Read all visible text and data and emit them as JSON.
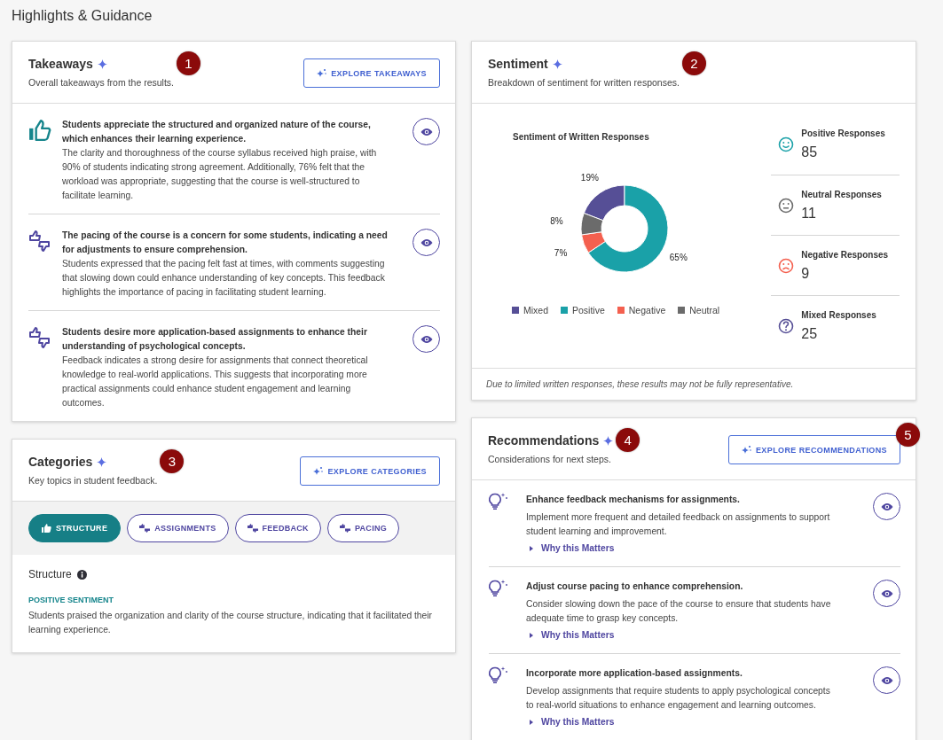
{
  "page_title": "Highlights & Guidance",
  "takeaways": {
    "title": "Takeaways",
    "subtitle": "Overall takeaways from the results.",
    "callout": "1",
    "button": "EXPLORE TAKEAWAYS",
    "items": [
      {
        "kind": "positive",
        "title": "Students appreciate the structured and organized nature of the course, which enhances their learning experience.",
        "text": "The clarity and thoroughness of the course syllabus received high praise, with 90% of students indicating strong agreement. Additionally, 76% felt that the workload was appropriate, suggesting that the course is well-structured to facilitate learning."
      },
      {
        "kind": "mixed",
        "title": "The pacing of the course is a concern for some students, indicating a need for adjustments to ensure comprehension.",
        "text": "Students expressed that the pacing felt fast at times, with comments suggesting that slowing down could enhance understanding of key concepts. This feedback highlights the importance of pacing in facilitating student learning."
      },
      {
        "kind": "mixed",
        "title": "Students desire more application-based assignments to enhance their understanding of psychological concepts.",
        "text": "Feedback indicates a strong desire for assignments that connect theoretical knowledge to real-world applications. This suggests that incorporating more practical assignments could enhance student engagement and learning outcomes."
      }
    ]
  },
  "categories": {
    "title": "Categories",
    "subtitle": "Key topics in student feedback.",
    "callout": "3",
    "button": "EXPLORE CATEGORIES",
    "tabs": [
      {
        "label": "STRUCTURE",
        "kind": "positive",
        "selected": true
      },
      {
        "label": "ASSIGNMENTS",
        "kind": "mixed",
        "selected": false
      },
      {
        "label": "FEEDBACK",
        "kind": "mixed",
        "selected": false
      },
      {
        "label": "PACING",
        "kind": "mixed",
        "selected": false
      }
    ],
    "detail": {
      "heading": "Structure",
      "sentiment": "POSITIVE SENTIMENT",
      "text": "Students praised the organization and clarity of the course structure, indicating that it facilitated their learning experience."
    }
  },
  "sentiment": {
    "title": "Sentiment",
    "subtitle": "Breakdown of sentiment for written responses.",
    "callout": "2",
    "chart_data": {
      "type": "donut",
      "title": "Sentiment of Written Responses",
      "categories": [
        "Mixed",
        "Positive",
        "Negative",
        "Neutral"
      ],
      "values": [
        19,
        65,
        7,
        8
      ],
      "colors": [
        "#564f96",
        "#1aa1a8",
        "#f4604f",
        "#6b6b6b"
      ],
      "value_labels": [
        "19%",
        "65%",
        "7%",
        "8%"
      ],
      "legend": true
    },
    "stats": [
      {
        "kind": "smile",
        "label": "Positive Responses",
        "value": "85",
        "color": "#1aa1a8"
      },
      {
        "kind": "neutral",
        "label": "Neutral Responses",
        "value": "11",
        "color": "#6b6b6b"
      },
      {
        "kind": "frown",
        "label": "Negative Responses",
        "value": "9",
        "color": "#f4604f"
      },
      {
        "kind": "question",
        "label": "Mixed Responses",
        "value": "25",
        "color": "#564f96"
      }
    ],
    "note": "Due to limited written responses, these results may not be fully representative."
  },
  "recommendations": {
    "title": "Recommendations",
    "subtitle": "Considerations for next steps.",
    "callout": "4",
    "button": "EXPLORE RECOMMENDATIONS",
    "button_callout": "5",
    "items": [
      {
        "title": "Enhance feedback mechanisms for assignments.",
        "text": "Implement more frequent and detailed feedback on assignments to support student learning and improvement.",
        "link": "Why this Matters"
      },
      {
        "title": "Adjust course pacing to enhance comprehension.",
        "text": "Consider slowing down the pace of the course to ensure that students have adequate time to grasp key concepts.",
        "link": "Why this Matters"
      },
      {
        "title": "Incorporate more application-based assignments.",
        "text": "Develop assignments that require students to apply psychological concepts to real-world situations to enhance engagement and learning outcomes.",
        "link": "Why this Matters"
      }
    ]
  }
}
